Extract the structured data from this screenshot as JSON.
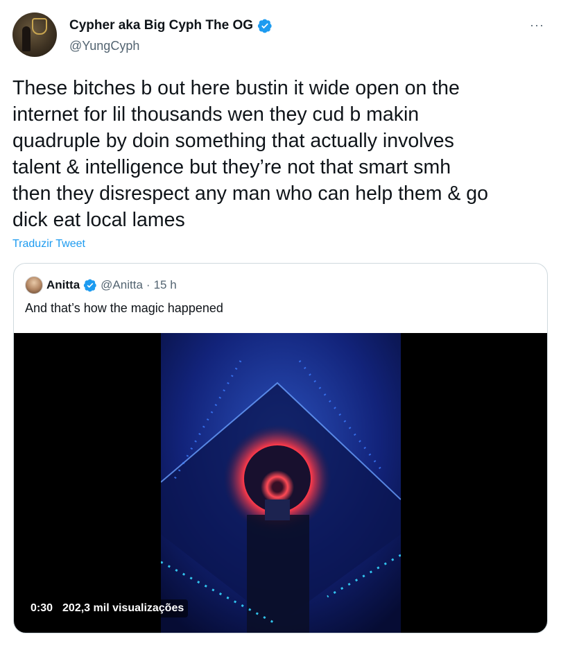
{
  "author": {
    "display_name": "Cypher aka Big Cyph The OG",
    "handle": "@YungCyph",
    "verified": true
  },
  "more_label": "···",
  "tweet": {
    "lines": [
      "These bitches b out here bustin it wide open on the",
      "internet for lil thousands wen they cud b makin",
      "quadruple by doin something that actually involves",
      "talent & intelligence but they’re not that smart smh",
      "then they disrespect any man who can help them & go",
      "dick eat local lames"
    ],
    "translate_label": "Traduzir Tweet"
  },
  "quoted": {
    "display_name": "Anitta",
    "handle": "@Anitta",
    "separator": "·",
    "time": "15 h",
    "text": "And that’s how the magic happened",
    "video": {
      "duration": "0:30",
      "views": "202,3 mil visualizações"
    }
  },
  "colors": {
    "link": "#1d9bf0",
    "verified": "#1d9bf0",
    "text": "#0f1419",
    "secondary": "#536471",
    "border": "#cfd9de"
  },
  "icons": [
    "verified-badge-icon",
    "more-icon"
  ]
}
